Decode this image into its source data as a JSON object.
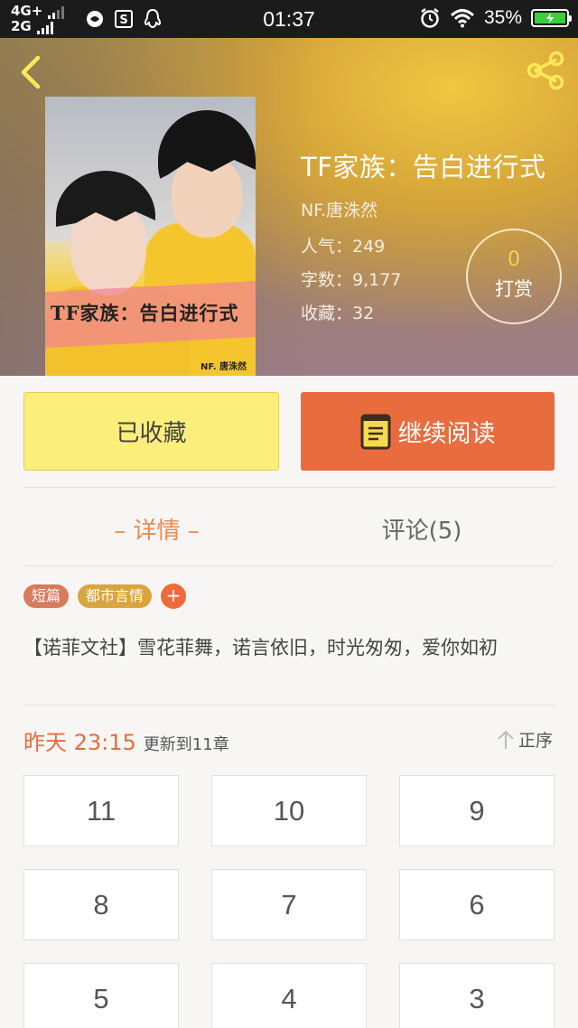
{
  "status_bar": {
    "network_top": "4G+",
    "network_bottom": "2G",
    "time": "01:37",
    "battery": "35%"
  },
  "book": {
    "title": "TF家族：告白进行式",
    "author": "NF.唐洙然",
    "popularity": "人气：249",
    "word_count": "字数：9,177",
    "favorites": "收藏：32",
    "cover_title": "TF家族：告白进行式",
    "cover_author": "NF. 唐洙然"
  },
  "tip": {
    "count": "0",
    "label": "打赏"
  },
  "actions": {
    "collected_label": "已收藏",
    "continue_label": "继续阅读"
  },
  "tabs": {
    "detail": "– 详情 –",
    "comments": "评论(5)"
  },
  "tags": [
    "短篇",
    "都市言情"
  ],
  "tag_add": "+",
  "description": "【诺菲文社】雪花菲舞，诺言依旧，时光匆匆，爱你如初",
  "update": {
    "date": "昨天 23:15",
    "text": "更新到11章"
  },
  "sort_label": "正序",
  "chapters": [
    "11",
    "10",
    "9",
    "8",
    "7",
    "6",
    "5",
    "4",
    "3"
  ],
  "colors": {
    "accent_orange": "#e86c3d",
    "collected_yellow": "#fbee7a",
    "tag_short": "#d87b5d",
    "tag_genre": "#d8a53e",
    "tab_active": "#e98a4c"
  },
  "icons": [
    "back-arrow-icon",
    "share-icon",
    "book-icon",
    "sort-up-arrow-icon",
    "alarm-icon",
    "wifi-icon",
    "battery-icon"
  ]
}
